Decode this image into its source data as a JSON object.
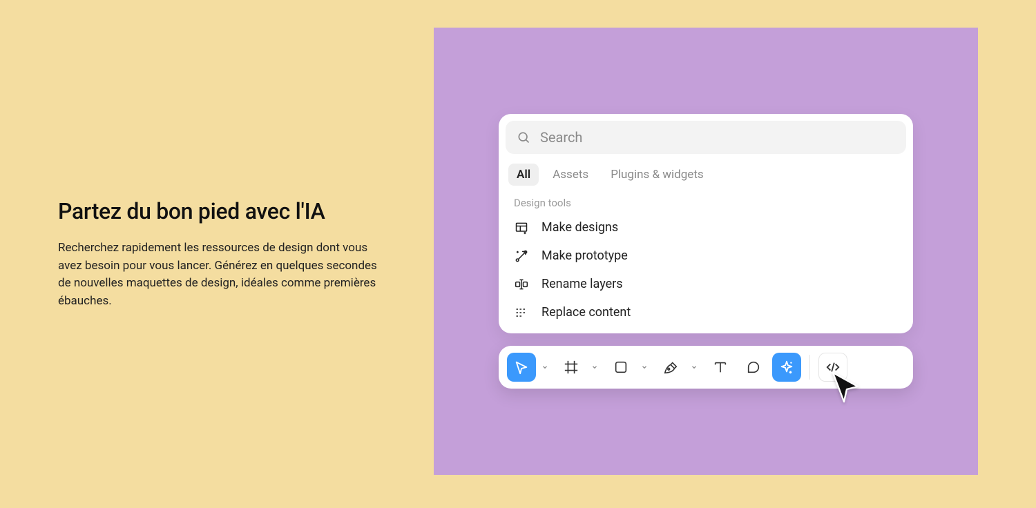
{
  "hero": {
    "heading": "Partez du bon pied avec l'IA",
    "body": "Recherchez rapidement les ressources de design dont vous avez besoin pour vous lancer. Générez en quelques secondes de nouvelles maquettes de design, idéales comme premières ébauches."
  },
  "search": {
    "placeholder": "Search"
  },
  "tabs": {
    "all": "All",
    "assets": "Assets",
    "plugins": "Plugins & widgets"
  },
  "section_label": "Design tools",
  "tools": {
    "make_designs": "Make designs",
    "make_prototype": "Make prototype",
    "rename_layers": "Rename layers",
    "replace_content": "Replace content"
  },
  "colors": {
    "bg": "#f4dda0",
    "canvas": "#c49fd9",
    "accent": "#3b99fc"
  }
}
